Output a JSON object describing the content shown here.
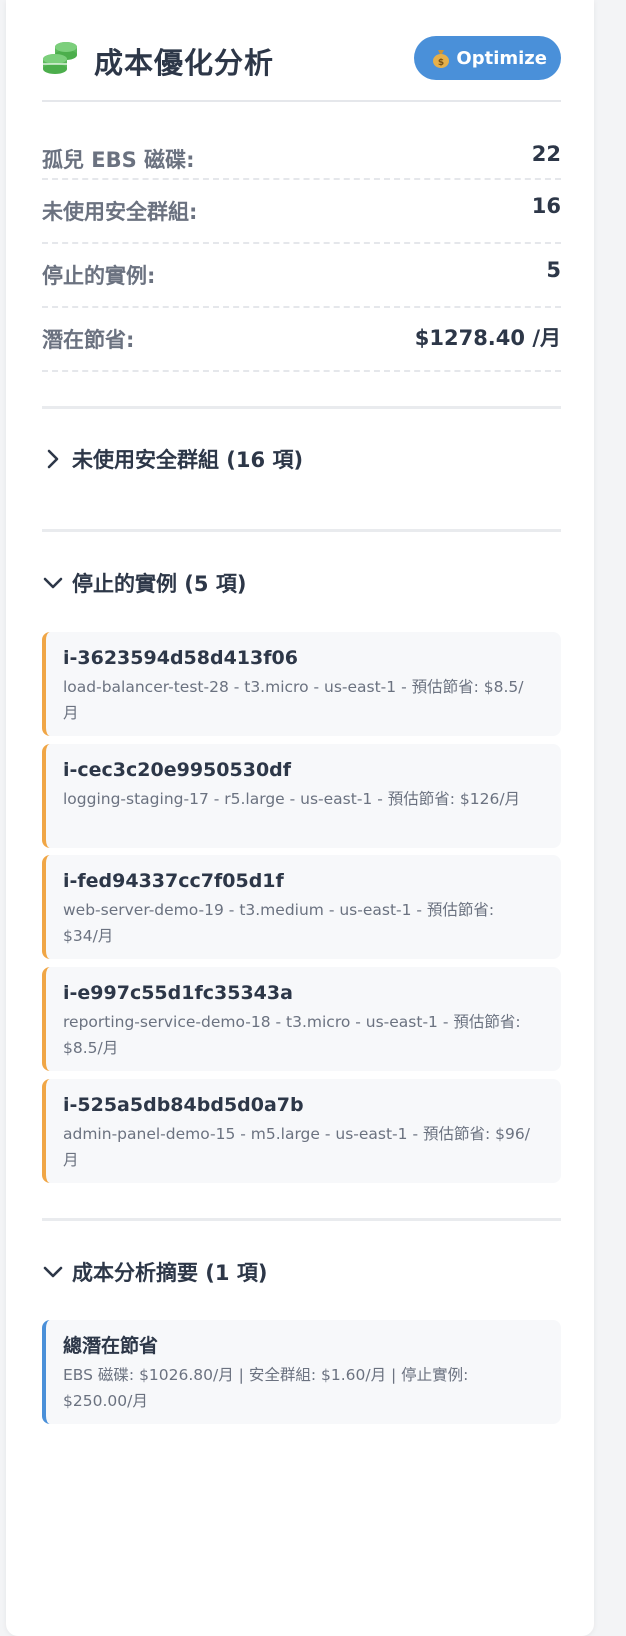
{
  "header": {
    "title": "成本優化分析",
    "optimize_label": "Optimize"
  },
  "stats": [
    {
      "label": "孤兒 EBS 磁碟:",
      "value": "22"
    },
    {
      "label": "未使用安全群組:",
      "value": "16"
    },
    {
      "label": "停止的實例:",
      "value": "5"
    },
    {
      "label": "潛在節省:",
      "value": "$1278.40 /月"
    }
  ],
  "sections": {
    "security_groups": {
      "title": "未使用安全群組 (16 項)"
    },
    "stopped": {
      "title": "停止的實例 (5 項)",
      "items": [
        {
          "id": "i-3623594d58d413f06",
          "desc": "load-balancer-test-28 - t3.micro - us-east-1 - 預估節省: $8.5/月"
        },
        {
          "id": "i-cec3c20e9950530df",
          "desc": "logging-staging-17 - r5.large - us-east-1 - 預估節省: $126/月"
        },
        {
          "id": "i-fed94337cc7f05d1f",
          "desc": "web-server-demo-19 - t3.medium - us-east-1 - 預估節省: $34/月"
        },
        {
          "id": "i-e997c55d1fc35343a",
          "desc": "reporting-service-demo-18 - t3.micro - us-east-1 - 預估節省: $8.5/月"
        },
        {
          "id": "i-525a5db84bd5d0a7b",
          "desc": "admin-panel-demo-15 - m5.large - us-east-1 - 預估節省: $96/月"
        }
      ]
    },
    "summary": {
      "title": "成本分析摘要 (1 項)",
      "items": [
        {
          "id": "總潛在節省",
          "desc": "EBS 磁碟: $1026.80/月 | 安全群組: $1.60/月 | 停止實例: $250.00/月"
        }
      ]
    }
  },
  "colors": {
    "accent": "#4a90d9",
    "warning": "#f0a646",
    "icon_green": "#5cb85c"
  },
  "icons": [
    "coins-icon",
    "money-bag-icon",
    "chevron-right-icon",
    "chevron-down-icon"
  ]
}
